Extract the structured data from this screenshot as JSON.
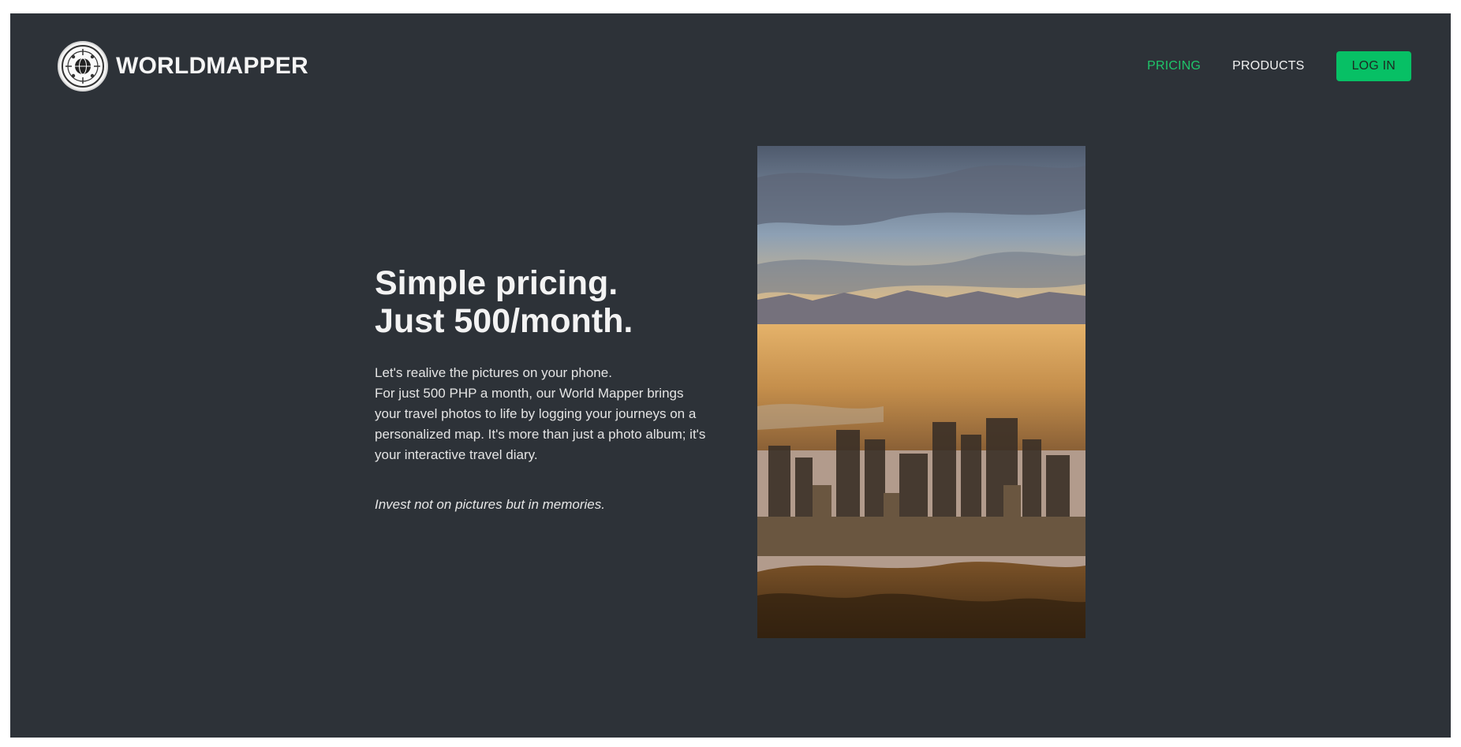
{
  "header": {
    "brand": "WORLDMAPPER",
    "logo_icon": "globe-seal-icon",
    "nav": [
      {
        "label": "PRICING",
        "active": true
      },
      {
        "label": "PRODUCTS",
        "active": false
      }
    ],
    "login_label": "LOG IN"
  },
  "hero": {
    "heading_line1": "Simple pricing.",
    "heading_line2": "Just 500/month.",
    "intro": "Let's realive the pictures on your phone.",
    "body": "For just 500 PHP a month, our World Mapper brings your travel photos to life by logging your journeys on a personalized map. It's more than just a photo album; it's your interactive travel diary.",
    "tagline": "Invest not on pictures but in memories.",
    "image_subject": "city-skyline-sunrise-photo"
  },
  "colors": {
    "background": "#2d3238",
    "accent": "#07c065",
    "active_link": "#1fc56a",
    "text": "#f3f3f3"
  }
}
